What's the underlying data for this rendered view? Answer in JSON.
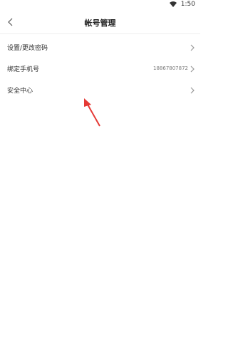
{
  "status_bar": {
    "time": "1:50",
    "wifi_icon": "wifi-icon"
  },
  "header": {
    "title": "帐号管理",
    "back_icon": "back-chevron-icon"
  },
  "list": {
    "items": [
      {
        "label": "设置/更改密码",
        "value": "",
        "icon": "chevron-right-icon"
      },
      {
        "label": "绑定手机号",
        "value": "18867807872",
        "icon": "chevron-right-icon"
      },
      {
        "label": "安全中心",
        "value": "",
        "icon": "chevron-right-icon"
      }
    ]
  },
  "annotation": {
    "icon": "red-arrow-icon",
    "color": "#e53935"
  },
  "colors": {
    "background": "#ffffff",
    "divider": "#eeeeee",
    "text": "#333333",
    "muted": "#777777"
  }
}
